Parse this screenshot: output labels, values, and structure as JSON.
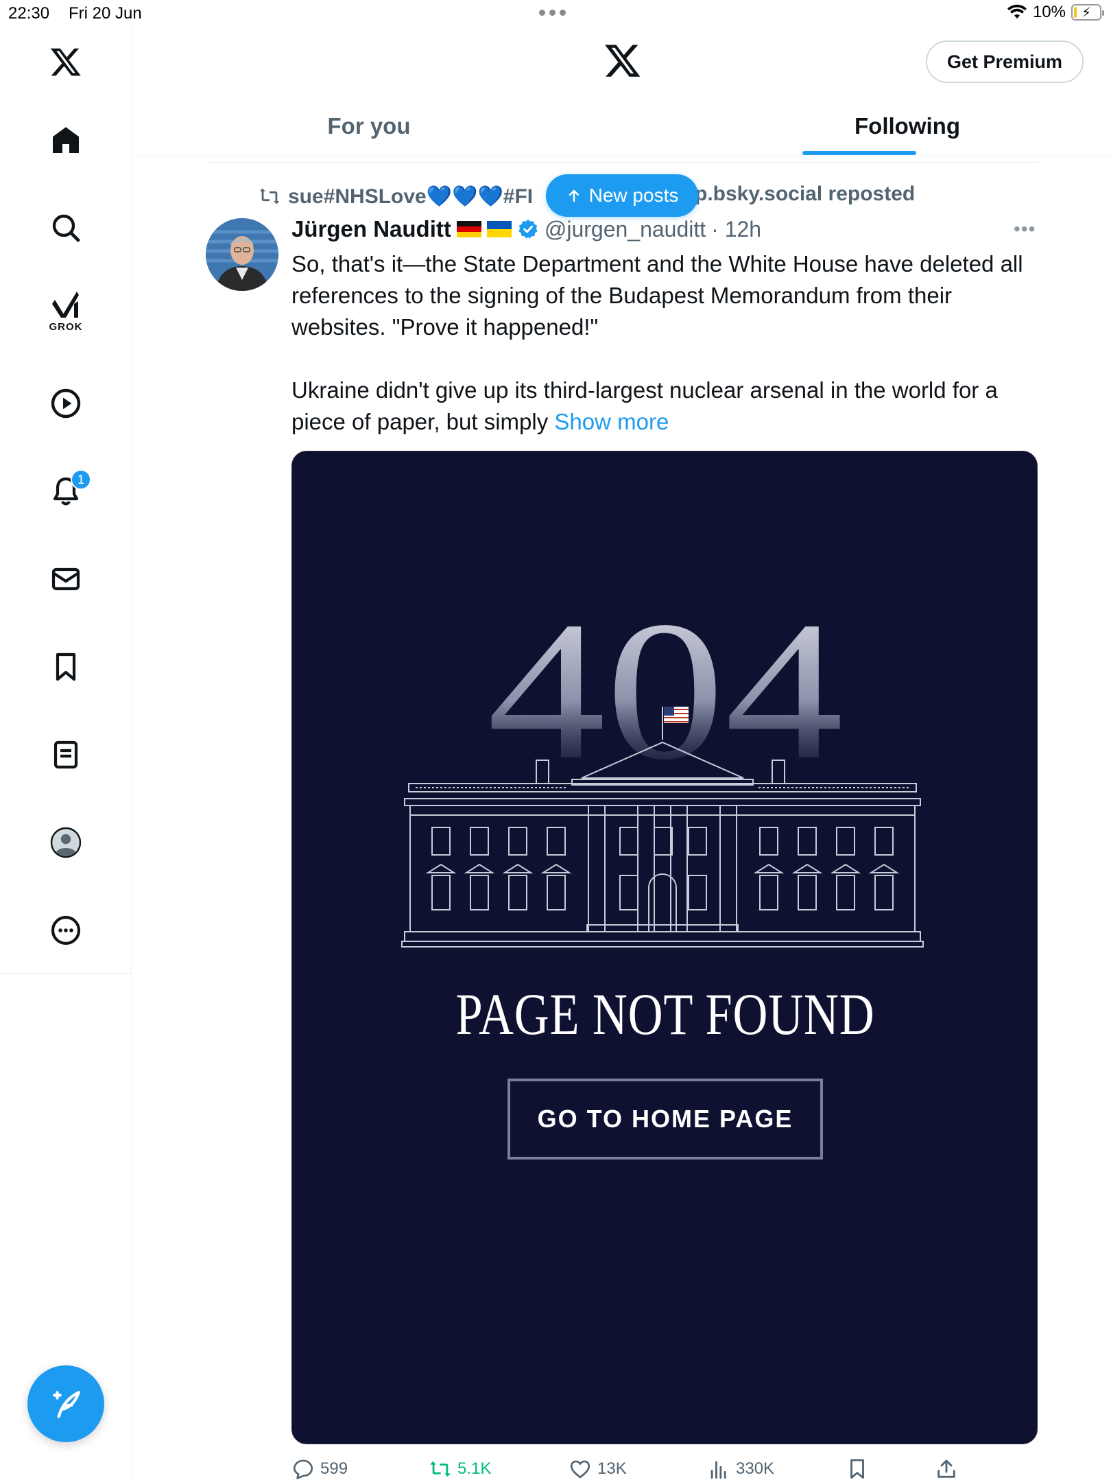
{
  "status_bar": {
    "time": "22:30",
    "date": "Fri 20 Jun",
    "battery": "10%",
    "battery_level": 0.1
  },
  "sidebar": {
    "grok_label": "GROK",
    "notification_count": "1",
    "items": [
      "home",
      "search",
      "grok",
      "videos",
      "notifications",
      "messages",
      "bookmarks",
      "lists",
      "profile",
      "more"
    ]
  },
  "header": {
    "premium_label": "Get Premium"
  },
  "tabs": {
    "for_you": "For you",
    "following": "Following",
    "active": "following"
  },
  "repost": {
    "left": "sue#NHSLove💙💙💙#FI",
    "right": "p.bsky.social reposted"
  },
  "new_posts": {
    "label": "New posts"
  },
  "post": {
    "author": "Jürgen Nauditt",
    "handle": "@jurgen_nauditt",
    "time": "· 12h",
    "more": "•••",
    "text_1": "So, that's it—the State Department and the White House have deleted all references to the signing of the Budapest Memorandum from their websites. \"Prove it happened!\"",
    "text_2": "Ukraine didn't give up its third-largest nuclear arsenal in the world for a piece of paper, but simply ",
    "show_more": "Show more",
    "media": {
      "big_number": "404",
      "title": "PAGE NOT FOUND",
      "button": "GO TO HOME PAGE"
    },
    "stats": {
      "replies": "599",
      "reposts": "5.1K",
      "likes": "13K",
      "views": "330K"
    }
  },
  "colors": {
    "accent": "#1d9bf0",
    "text_secondary": "#536471",
    "media_bg": "#0f1131",
    "repost_green": "#00ba7c"
  }
}
